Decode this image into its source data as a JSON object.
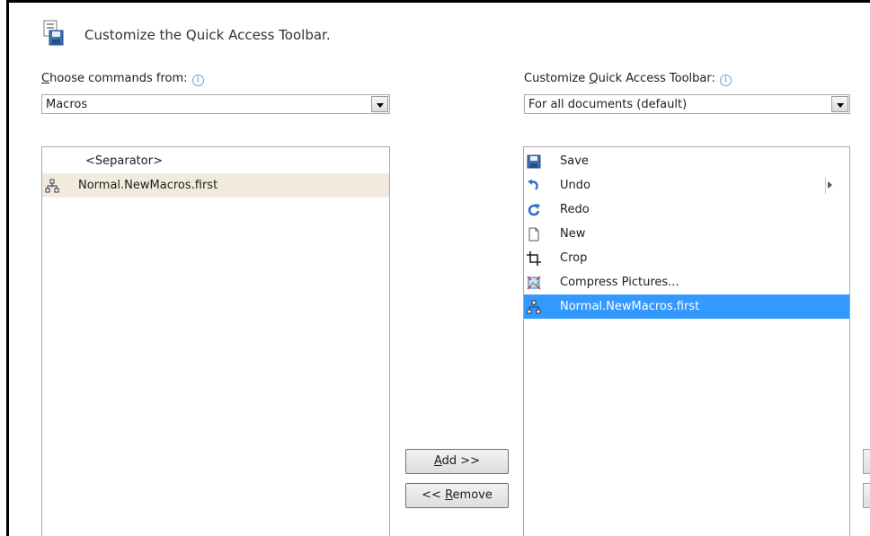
{
  "header": {
    "title": "Customize the Quick Access Toolbar."
  },
  "left": {
    "label_prefix": "",
    "label_accel": "C",
    "label_rest": "hoose commands from:",
    "info": "i",
    "combo_value": "Macros",
    "items": [
      {
        "label": "<Separator>",
        "icon": "separator",
        "selected": false
      },
      {
        "label": "Normal.NewMacros.first",
        "icon": "macro-icon",
        "selected": true
      }
    ]
  },
  "right": {
    "label_prefix": "Customize ",
    "label_accel": "Q",
    "label_rest": "uick Access Toolbar:",
    "info": "i",
    "combo_value": "For all documents (default)",
    "items": [
      {
        "label": "Save",
        "icon": "save-icon"
      },
      {
        "label": "Undo",
        "icon": "undo-icon"
      },
      {
        "label": "Redo",
        "icon": "redo-icon"
      },
      {
        "label": "New",
        "icon": "new-document-icon"
      },
      {
        "label": "Crop",
        "icon": "crop-icon"
      },
      {
        "label": "Compress Pictures...",
        "icon": "compress-pictures-icon"
      },
      {
        "label": "Normal.NewMacros.first",
        "icon": "macro-icon"
      }
    ]
  },
  "buttons": {
    "add_accel": "A",
    "add_rest": "dd >>",
    "remove_prefix": "<< ",
    "remove_accel": "R",
    "remove_rest": "emove"
  },
  "colors": {
    "selection_blue": "#3399ff",
    "selection_beige": "#f0ebdd"
  }
}
